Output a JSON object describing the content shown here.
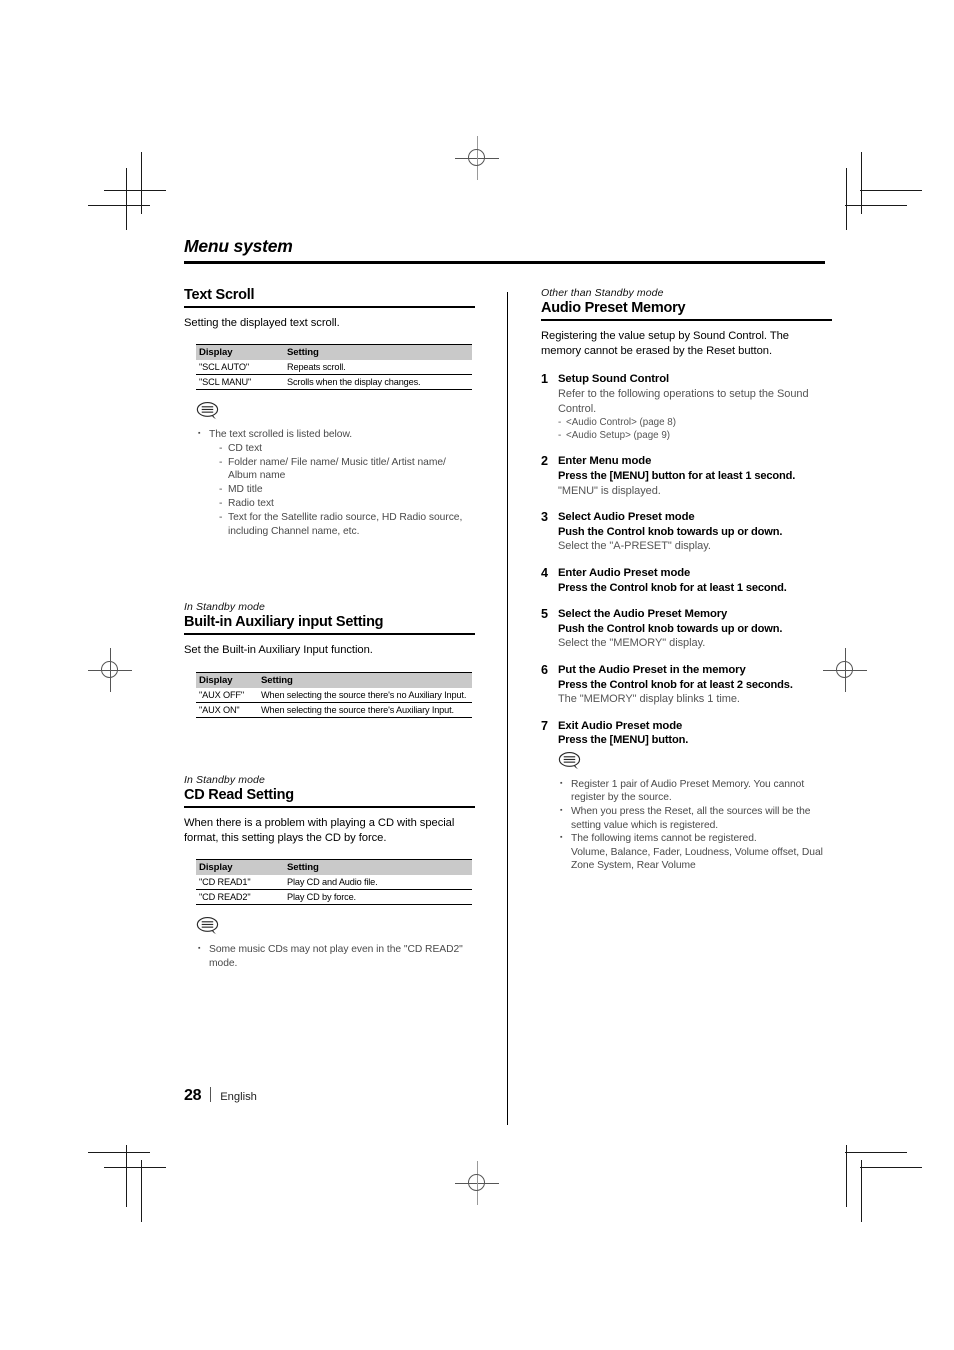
{
  "running_head": "Menu system",
  "footer": {
    "page_number": "28",
    "language": "English"
  },
  "left_column": {
    "sections": [
      {
        "eyebrow": "",
        "heading": "Text Scroll",
        "lead": "Setting the displayed text scroll.",
        "table": {
          "headers": [
            "Display",
            "Setting"
          ],
          "rows": [
            [
              "\"SCL AUTO\"",
              "Repeats scroll."
            ],
            [
              "\"SCL MANU\"",
              "Scrolls when the display changes."
            ]
          ]
        },
        "note": {
          "icon": "note-bubble-icon",
          "items": [
            {
              "text": "The text scrolled is listed below.",
              "sub": [
                "CD text",
                "Folder name/ File name/ Music title/ Artist name/ Album name",
                "MD title",
                "Radio text",
                "Text for the Satellite radio source, HD Radio source, including Channel name, etc."
              ]
            }
          ]
        }
      },
      {
        "eyebrow": "In Standby mode",
        "heading": "Built-in Auxiliary input Setting",
        "lead": "Set the Built-in Auxiliary Input function.",
        "table": {
          "headers": [
            "Display",
            "Setting"
          ],
          "rows": [
            [
              "\"AUX OFF\"",
              "When selecting the source there's no Auxiliary Input."
            ],
            [
              "\"AUX ON\"",
              "When selecting the source there's Auxiliary Input."
            ]
          ]
        }
      },
      {
        "eyebrow": "In Standby mode",
        "heading": "CD Read Setting",
        "lead": "When there is a problem with playing a CD with special format, this setting plays the CD by force.",
        "table": {
          "headers": [
            "Display",
            "Setting"
          ],
          "rows": [
            [
              "\"CD READ1\"",
              "Play CD and Audio file."
            ],
            [
              "\"CD READ2\"",
              "Play CD by force."
            ]
          ]
        },
        "note": {
          "icon": "note-bubble-icon",
          "items": [
            {
              "text": "Some music CDs may not play even in the \"CD READ2\" mode.",
              "sub": []
            }
          ]
        }
      }
    ]
  },
  "right_column": {
    "eyebrow": "Other than Standby mode",
    "heading": "Audio Preset Memory",
    "lead": "Registering the value setup by Sound Control. The memory cannot be erased by the Reset button.",
    "steps": [
      {
        "num": "1",
        "title": "Setup Sound Control",
        "action": "",
        "detail": "Refer to the following operations to setup the Sound Control.",
        "refs": [
          "<Audio Control> (page 8)",
          "<Audio Setup> (page 9)"
        ]
      },
      {
        "num": "2",
        "title": "Enter Menu mode",
        "action": "Press the [MENU] button for at least 1 second.",
        "detail": "\"MENU\" is displayed.",
        "refs": []
      },
      {
        "num": "3",
        "title": "Select Audio Preset mode",
        "action": "Push the Control knob towards up or down.",
        "detail": "Select the \"A-PRESET\" display.",
        "refs": []
      },
      {
        "num": "4",
        "title": "Enter Audio Preset mode",
        "action": "Press the Control knob for at least 1 second.",
        "detail": "",
        "refs": []
      },
      {
        "num": "5",
        "title": "Select the Audio Preset Memory",
        "action": "Push the Control knob towards up or down.",
        "detail": "Select the \"MEMORY\" display.",
        "refs": []
      },
      {
        "num": "6",
        "title": "Put the Audio Preset in the memory",
        "action": "Press the Control knob for at least 2 seconds.",
        "detail": "The \"MEMORY\" display blinks 1 time.",
        "refs": []
      },
      {
        "num": "7",
        "title": "Exit Audio Preset mode",
        "action": "Press the [MENU] button.",
        "detail": "",
        "refs": []
      }
    ],
    "note": {
      "icon": "note-bubble-icon",
      "items": [
        {
          "text": "Register 1 pair of Audio Preset Memory. You cannot register by the source.",
          "sub": []
        },
        {
          "text": "When you press the Reset, all the sources will be the setting value which is registered.",
          "sub": []
        },
        {
          "text": "The following items cannot be registered.",
          "sub": []
        }
      ],
      "trailing": "Volume, Balance, Fader, Loudness, Volume offset, Dual Zone System, Rear Volume"
    }
  }
}
